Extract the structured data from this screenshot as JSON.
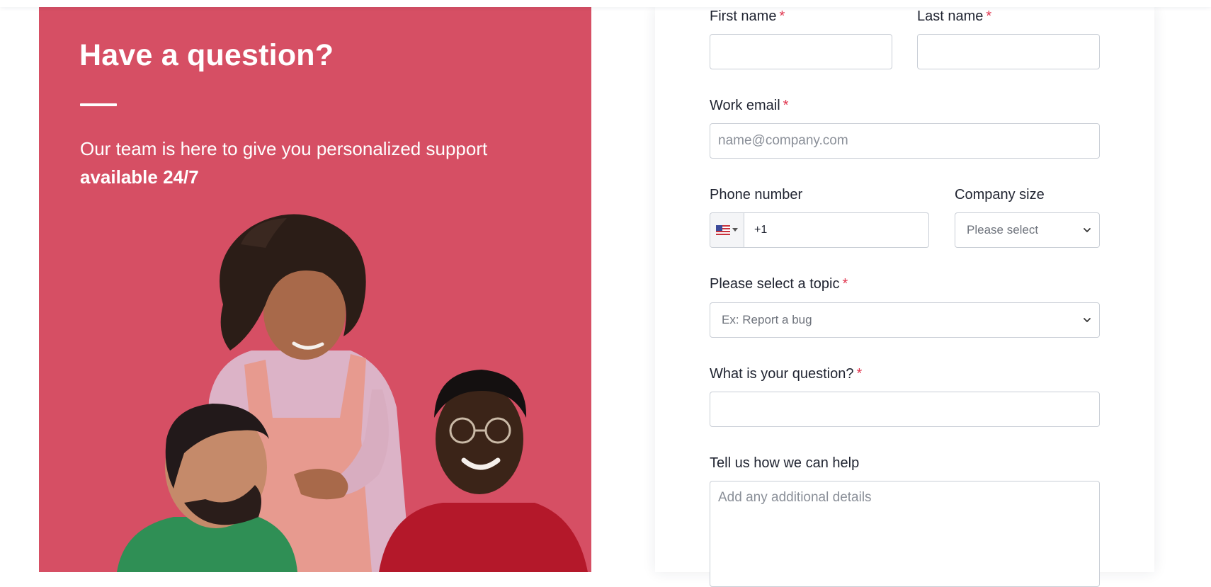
{
  "promo": {
    "title": "Have a question?",
    "text": "Our team is here to give you personalized support",
    "text_bold": "available 24/7"
  },
  "form": {
    "first_name": {
      "label": "First name",
      "required": "*",
      "value": ""
    },
    "last_name": {
      "label": "Last name",
      "required": "*",
      "value": ""
    },
    "work_email": {
      "label": "Work email",
      "required": "*",
      "placeholder": "name@company.com"
    },
    "phone": {
      "label": "Phone number",
      "country_code": "+1",
      "flag": "us-flag-icon"
    },
    "company_size": {
      "label": "Company size",
      "selected": "Please select"
    },
    "topic": {
      "label": "Please select a topic",
      "required": "*",
      "selected": "Ex: Report a bug"
    },
    "question": {
      "label": "What is your question?",
      "required": "*",
      "value": ""
    },
    "help": {
      "label": "Tell us how we can help",
      "placeholder": "Add any additional details"
    }
  },
  "colors": {
    "promo_bg": "#d64f64",
    "required_mark": "#e0364f",
    "border": "#c9ced6"
  },
  "icons": [
    "chevron-down-icon",
    "us-flag-icon",
    "caret-down-icon"
  ]
}
